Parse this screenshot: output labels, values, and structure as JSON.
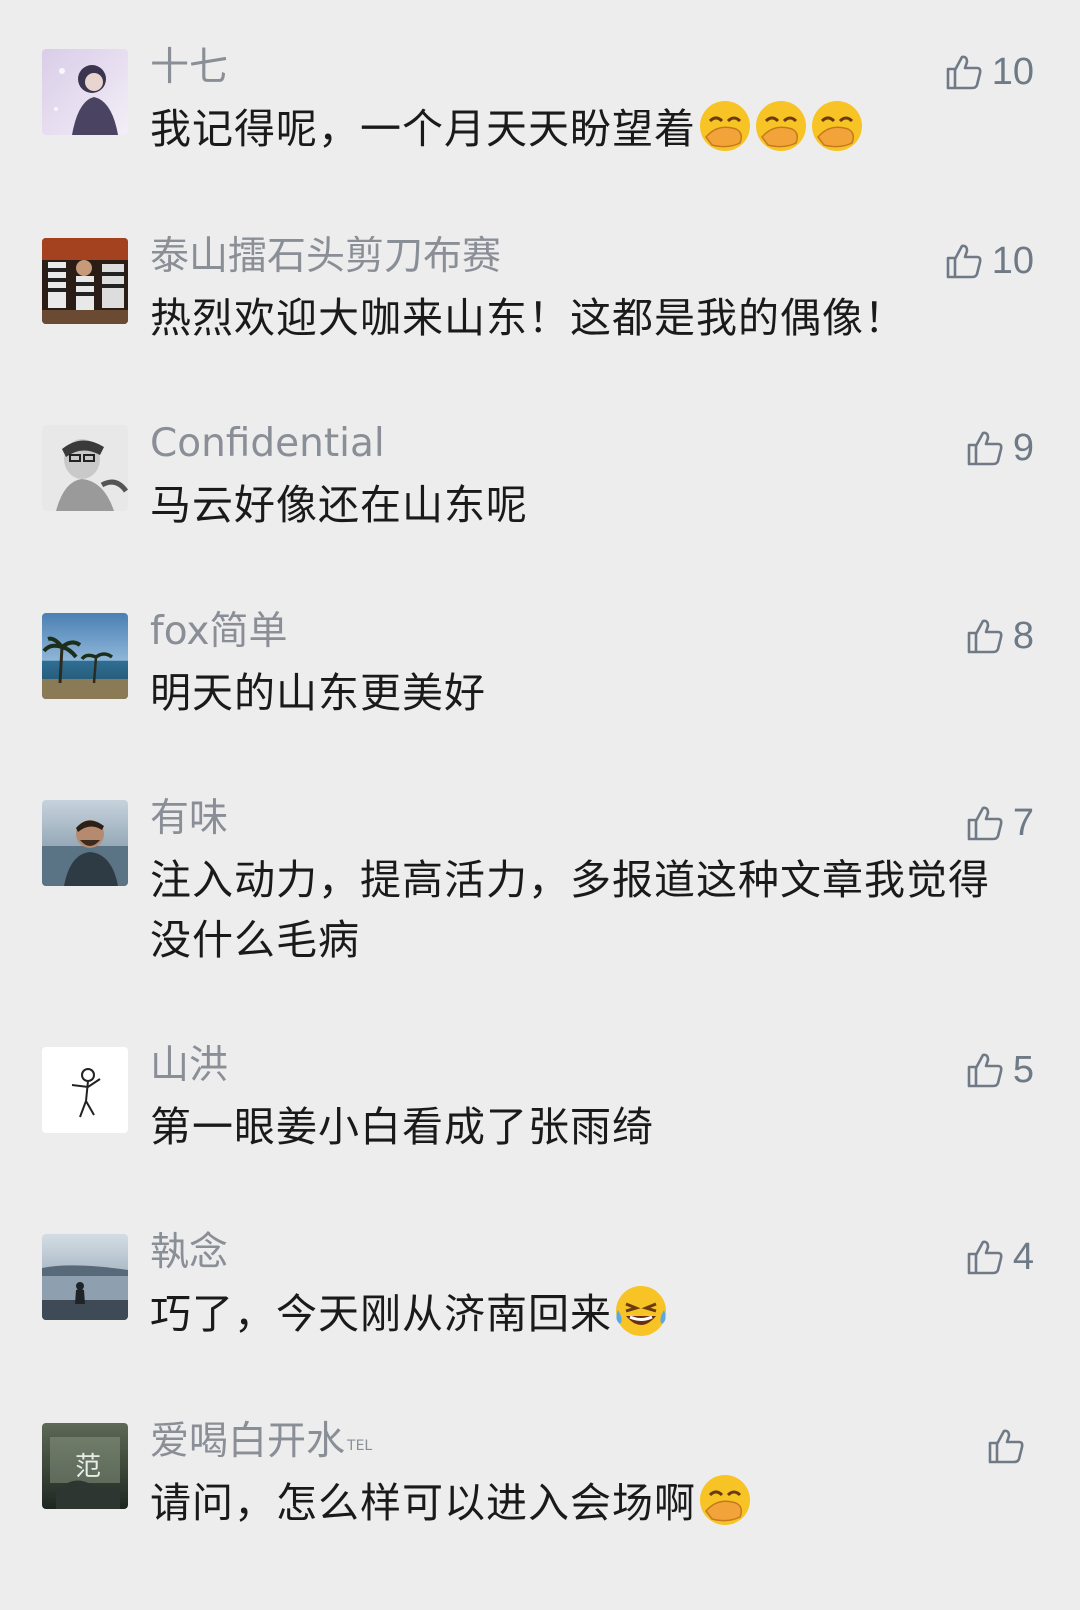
{
  "comments": [
    {
      "name": "十七",
      "text": "我记得呢，一个月天天盼望着",
      "likes": "10",
      "emoji": "facepalm",
      "emoji_count": 3
    },
    {
      "name": "泰山擂石头剪刀布赛",
      "text": "热烈欢迎大咖来山东！这都是我的偶像！",
      "likes": "10"
    },
    {
      "name": "Confidential",
      "text": "马云好像还在山东呢",
      "likes": "9"
    },
    {
      "name": "fox简单",
      "text": "明天的山东更美好",
      "likes": "8"
    },
    {
      "name": "有味",
      "text": "注入动力，提高活力，多报道这种文章我觉得没什么毛病",
      "likes": "7"
    },
    {
      "name": "山洪",
      "text": "第一眼姜小白看成了张雨绮",
      "likes": "5"
    },
    {
      "name": "執念",
      "text": "巧了，今天刚从济南回来",
      "likes": "4",
      "emoji": "laugh-tears",
      "emoji_count": 1
    },
    {
      "name": "爱喝白开水",
      "name_tag": "TEL",
      "text": "请问，怎么样可以进入会场啊",
      "likes": "",
      "emoji": "facepalm",
      "emoji_count": 1
    }
  ],
  "avatar_8_char": "范",
  "colors": {
    "background": "#ededed",
    "name": "#8a8f97",
    "text": "#1a1a1a",
    "like_icon": "#707a86"
  }
}
